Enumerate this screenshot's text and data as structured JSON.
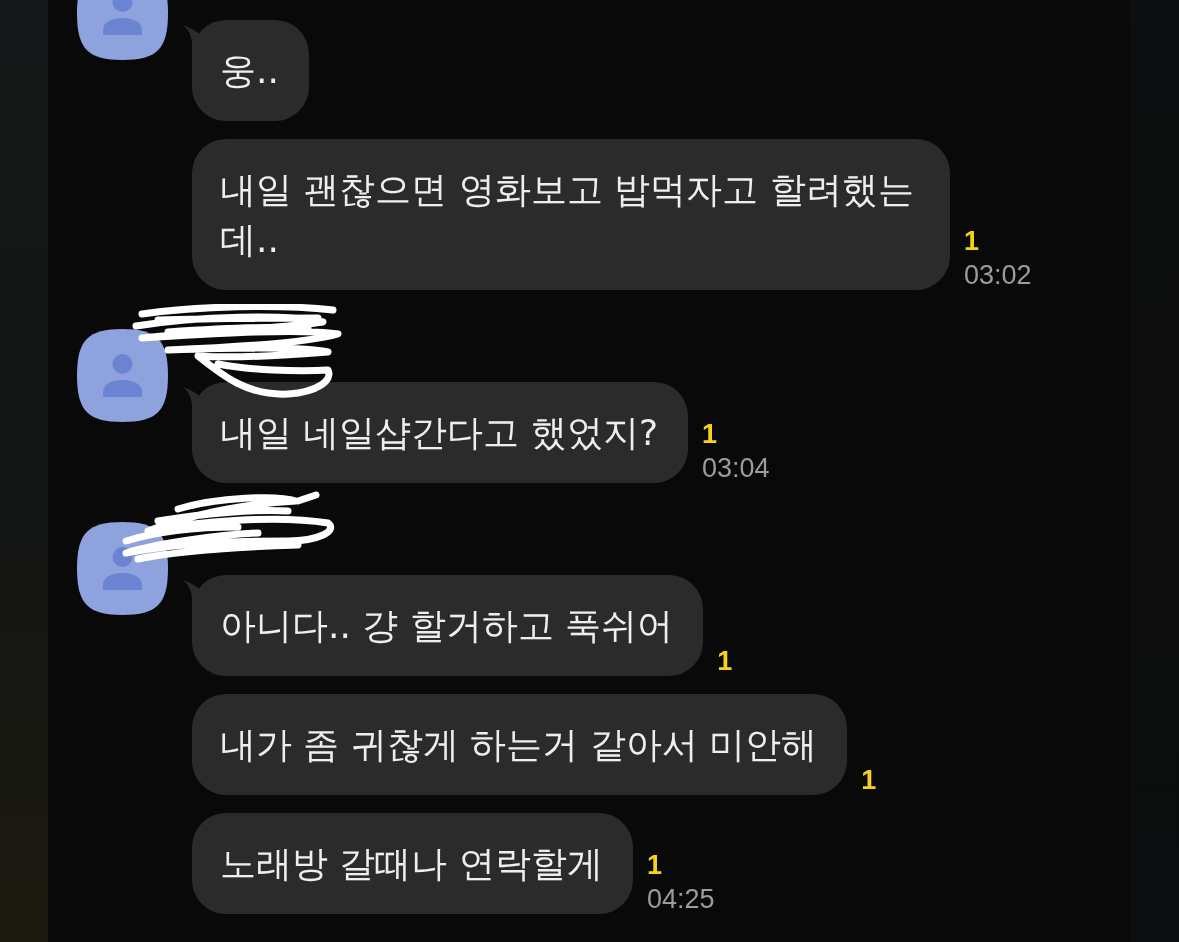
{
  "chat": {
    "groups": [
      {
        "messages": [
          {
            "text": "웅.."
          },
          {
            "text": "내일 괜찮으면 영화보고 밥먹자고 할려했는데..",
            "unread": "1",
            "time": "03:02"
          }
        ]
      },
      {
        "name_redacted": true,
        "messages": [
          {
            "text": "내일 네일샵간다고 했었지?",
            "unread": "1",
            "time": "03:04"
          }
        ]
      },
      {
        "name_redacted": true,
        "messages": [
          {
            "text": "아니다.. 걍 할거하고 푹쉬어",
            "unread": "1"
          },
          {
            "text": "내가 좀 귀찮게 하는거 같아서 미안해",
            "unread": "1"
          },
          {
            "text": "노래방 갈때나 연락할게",
            "unread": "1",
            "time": "04:25"
          }
        ]
      }
    ]
  }
}
